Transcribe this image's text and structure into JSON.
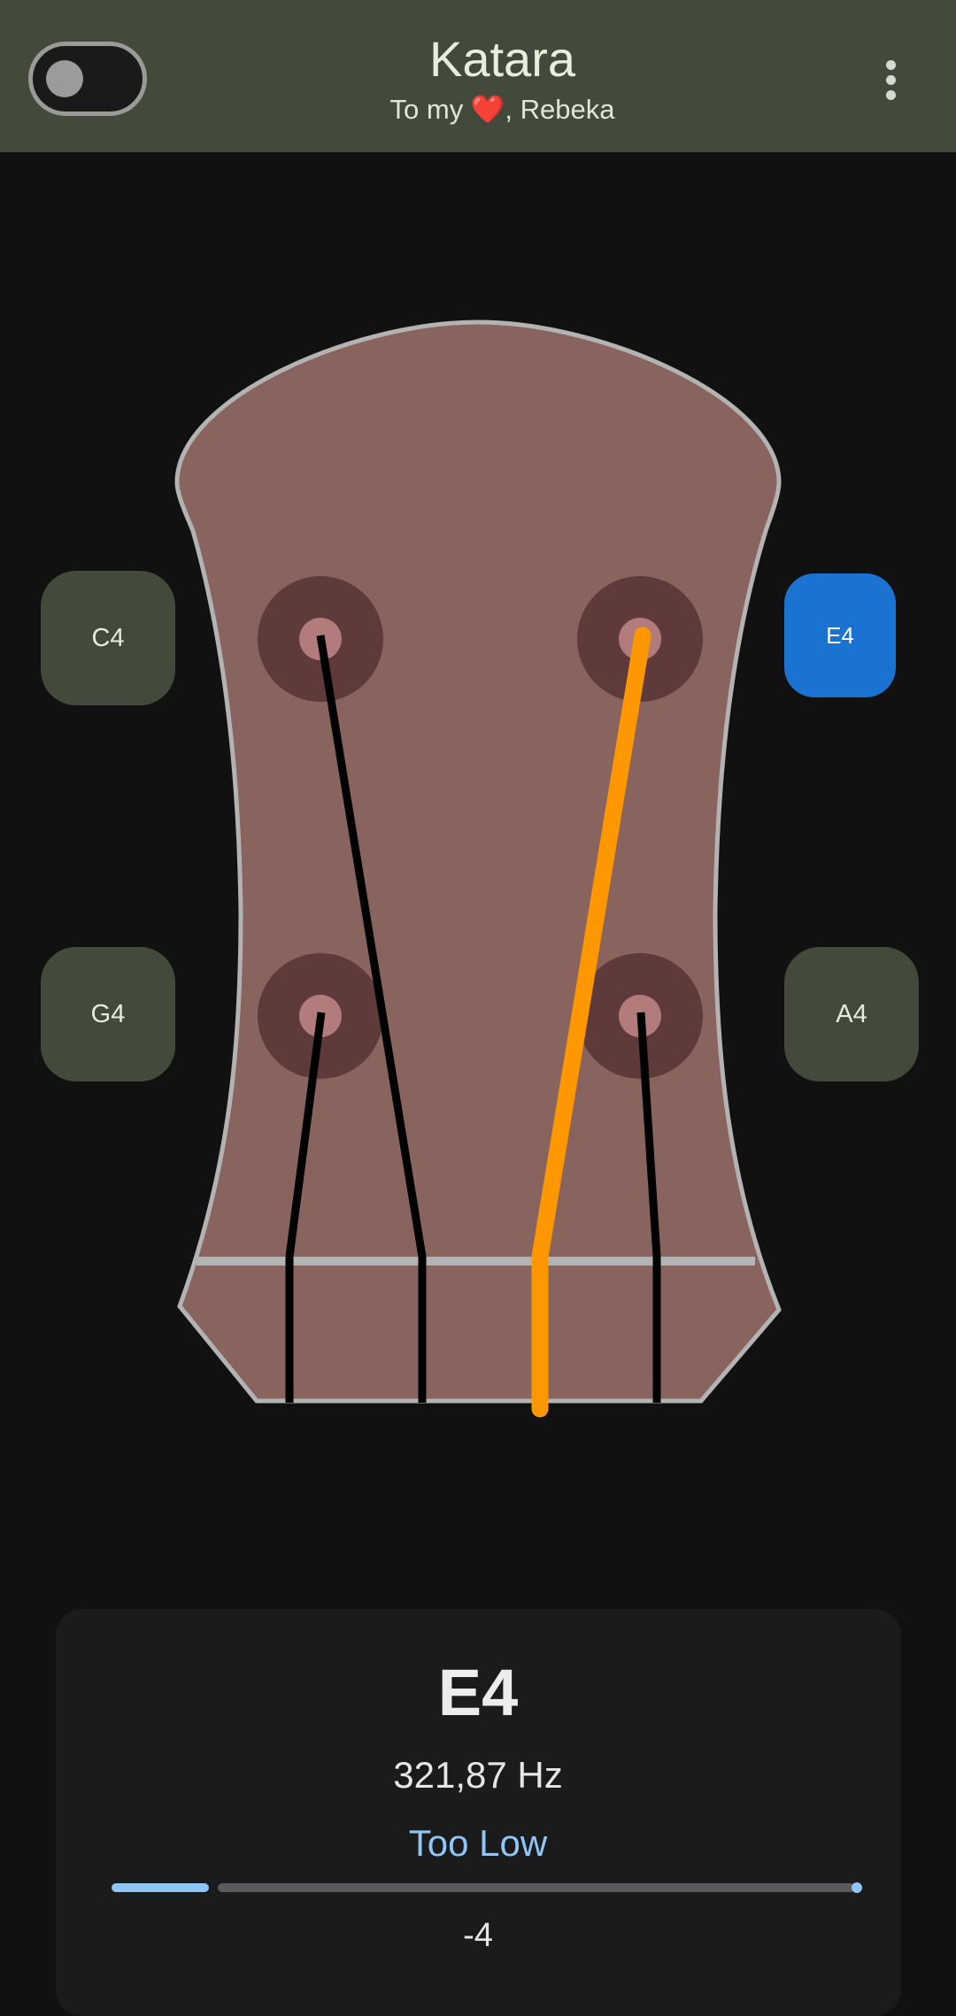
{
  "appbar": {
    "title": "Katara",
    "subtitle": "To my ❤️, Rebeka"
  },
  "pegs": {
    "c4": "C4",
    "e4": "E4",
    "g4": "G4",
    "a4": "A4",
    "selected": "E4"
  },
  "tuner": {
    "note": "E4",
    "frequency": "321,87 Hz",
    "status": "Too Low",
    "cents": "-4"
  },
  "colors": {
    "appbar": "#434a3b",
    "headstock": "#89635e",
    "active_string": "#ff9800",
    "selected_peg": "#1a73d1",
    "status": "#90c6f5"
  }
}
